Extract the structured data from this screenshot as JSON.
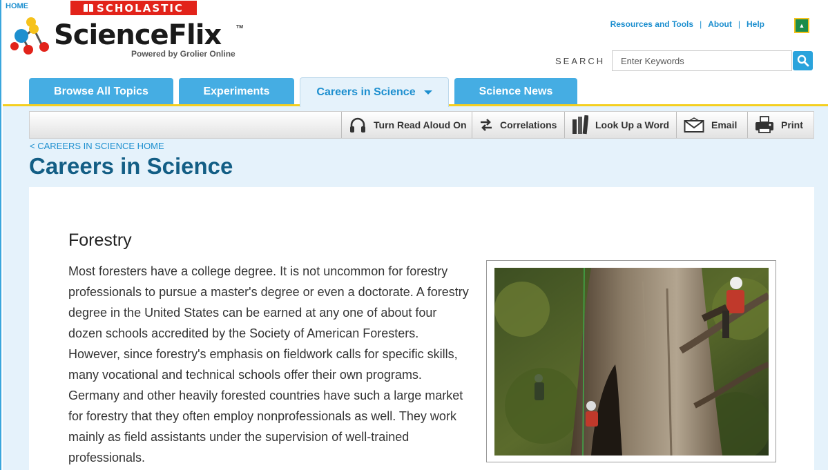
{
  "header": {
    "home_link": "HOME",
    "brand_badge": "SCHOLASTIC",
    "logo_name": "ScienceFlix",
    "logo_tm": "TM",
    "logo_tagline": "Powered by Grolier Online"
  },
  "utility_nav": {
    "items": [
      "Resources and Tools",
      "About",
      "Help"
    ],
    "separator": "|"
  },
  "search": {
    "label": "SEARCH",
    "placeholder": "Enter Keywords"
  },
  "tabs": [
    {
      "label": "Browse All Topics",
      "active": false
    },
    {
      "label": "Experiments",
      "active": false
    },
    {
      "label": "Careers in Science",
      "active": true
    },
    {
      "label": "Science News",
      "active": false
    }
  ],
  "toolbar": {
    "items": [
      {
        "label": "Turn Read Aloud On",
        "icon": "headphones-icon"
      },
      {
        "label": "Correlations",
        "icon": "swap-arrows-icon"
      },
      {
        "label": "Look Up a Word",
        "icon": "books-icon"
      },
      {
        "label": "Email",
        "icon": "envelope-icon"
      },
      {
        "label": "Print",
        "icon": "printer-icon"
      }
    ]
  },
  "breadcrumb": "< CAREERS IN SCIENCE HOME",
  "page_title": "Careers in Science",
  "article": {
    "heading": "Forestry",
    "body": "Most foresters have a college degree. It is not uncommon for forestry professionals to pursue a master's degree or even a doctorate. A forestry degree in the United States can be earned at any one of about four dozen schools accredited by the Society of American Foresters. However, since forestry's emphasis on fieldwork calls for specific skills, many vocational and technical schools offer their own programs. Germany and other heavily forested countries have such a large market for forestry that they often employ nonprofessionals as well. They work mainly as field assistants under the supervision of well-trained professionals.",
    "image_subject": "foresters climbing a giant tree trunk with ropes and helmets"
  },
  "colors": {
    "brand_blue": "#45ade3",
    "link_blue": "#1d8fcf",
    "title_blue": "#135e85",
    "scholastic_red": "#e2231a",
    "accent_yellow": "#f4cf1f",
    "content_bg": "#e5f2fb"
  }
}
